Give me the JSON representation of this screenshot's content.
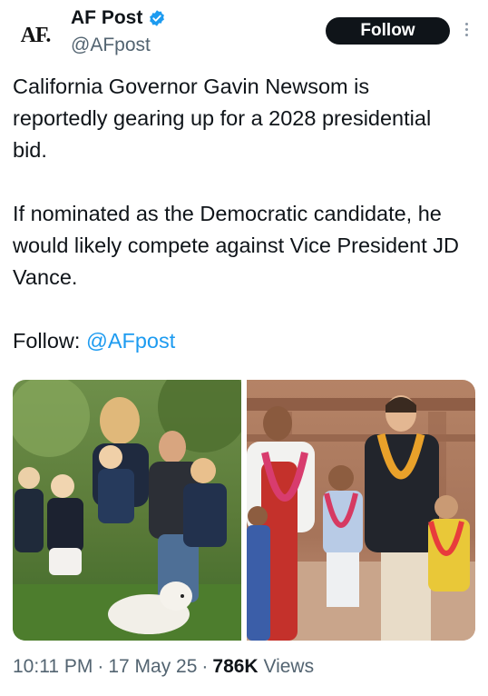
{
  "author": {
    "avatar_text": "AF.",
    "display_name": "AF Post",
    "handle": "@AFpost",
    "verified_icon": "verified-badge-icon"
  },
  "follow_button": {
    "label": "Follow"
  },
  "tweet": {
    "paragraph_1": "California Governor Gavin Newsom is reportedly gearing up for a 2028 presidential bid.",
    "paragraph_2": "If nominated as the Democratic candidate, he would likely compete against Vice President JD Vance.",
    "follow_prefix": "Follow: ",
    "follow_mention": "@AFpost"
  },
  "meta": {
    "time": "10:11 PM",
    "date": "17 May 25",
    "views_count": "786K",
    "views_label": "Views",
    "separator": "·"
  },
  "colors": {
    "accent": "#1d9bf0",
    "text": "#0f1419",
    "secondary": "#536471"
  }
}
